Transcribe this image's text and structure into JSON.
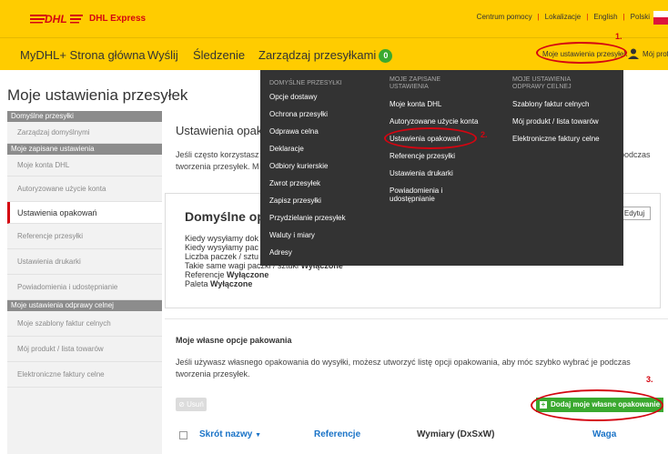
{
  "brand": {
    "name": "DHL Express",
    "logo_text": "DHL"
  },
  "top_links": [
    "Centrum pomocy",
    "Lokalizacje",
    "English",
    "Polski"
  ],
  "nav": {
    "home": "MyDHL+ Strona główna",
    "send": "Wyślij",
    "track": "Śledzenie",
    "manage": "Zarządzaj przesyłkami",
    "manage_badge": "0",
    "settings": "Moje ustawienia przesyłek",
    "profile": "Mój profil"
  },
  "page_title": "Moje ustawienia przesyłek",
  "sidebar": {
    "sections": [
      {
        "header": "Domyślne przesyłki",
        "items": [
          "Zarządzaj domyślnymi"
        ]
      },
      {
        "header": "Moje zapisane ustawienia",
        "items": [
          "Moje konta DHL",
          "Autoryzowane użycie konta",
          "Ustawienia opakowań",
          "Referencje przesyłki",
          "Ustawienia drukarki",
          "Powiadomienia i udostępnianie"
        ]
      },
      {
        "header": "Moje ustawienia odprawy celnej",
        "items": [
          "Moje szablony faktur celnych",
          "Mój produkt / lista towarów",
          "Elektroniczne faktury celne"
        ]
      }
    ]
  },
  "main": {
    "title": "Ustawienia opak",
    "intro_line1": "Jeśli często korzystasz",
    "intro_line1_right": "podczas",
    "intro_line2": "tworzenia przesyłek. M",
    "card": {
      "title": "Domyślne opa",
      "edit": "Edytuj",
      "line1": "Kiedy wysyłamy dok",
      "line2": "Kiedy wysyłamy pac",
      "line3": "Liczba paczek / sztu",
      "line4_label": "Takie same wagi paczki / sztuki",
      "line4_value": "Wyłączone",
      "line5_label": "Referencje",
      "line5_value": "Wyłączone",
      "line6_label": "Paleta",
      "line6_value": "Wyłączone"
    },
    "custom": {
      "title": "Moje własne opcje pakowania",
      "text": "Jeśli używasz własnego opakowania do wysyłki, możesz utworzyć listę opcji opakowania, aby móc szybko wybrać je podczas tworzenia przesyłek.",
      "delete": "Usuń",
      "add": "Dodaj moje własne opakowanie"
    },
    "table_headers": {
      "name": "Skrót nazwy",
      "sort_icon": "▼",
      "refs": "Referencje",
      "dims": "Wymiary (DxSxW)",
      "weight": "Waga"
    }
  },
  "dropdown": {
    "col1": {
      "header": "DOMYŚLNE PRZESYŁKI",
      "items": [
        "Opcje dostawy",
        "Ochrona przesyłki",
        "Odprawa celna",
        "Deklaracje",
        "Odbiory kurierskie",
        "Zwrot przesyłek",
        "Zapisz przesyłki",
        "Przydzielanie przesyłek",
        "Waluty i miary",
        "Adresy"
      ]
    },
    "col2": {
      "header_l1": "MOJE ZAPISANE",
      "header_l2": "USTAWIENIA",
      "items": [
        "Moje konta DHL",
        "Autoryzowane użycie konta",
        "Ustawienia opakowań",
        "Referencje przesyłki",
        "Ustawienia drukarki"
      ],
      "last_l1": "Powiadomienia i",
      "last_l2": "udostępnianie"
    },
    "col3": {
      "header_l1": "MOJE USTAWIENIA",
      "header_l2": "ODPRAWY CELNEJ",
      "items": [
        "Szablony faktur celnych",
        "Mój produkt / lista towarów",
        "Elektroniczne faktury celne"
      ]
    }
  },
  "annotations": [
    "1.",
    "2.",
    "3."
  ],
  "colors": {
    "dhl_yellow": "#ffcc00",
    "dhl_red": "#d40511",
    "green": "#3aa92f",
    "link_blue": "#1a73c7",
    "dropdown_bg": "#333333"
  }
}
